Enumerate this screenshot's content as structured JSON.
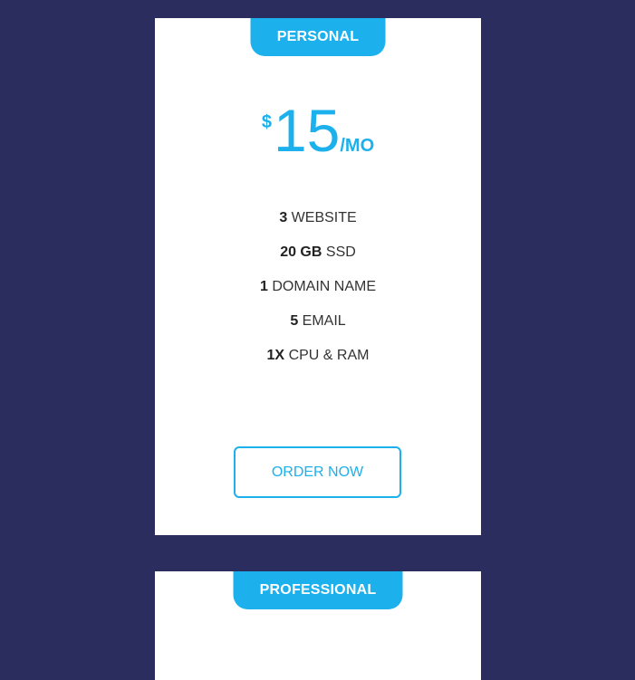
{
  "plans": [
    {
      "name": "PERSONAL",
      "currency": "$",
      "price": "15",
      "period": "/MO",
      "features": [
        {
          "value": "3",
          "label": "WEBSITE"
        },
        {
          "value": "20 GB",
          "label": "SSD"
        },
        {
          "value": "1",
          "label": "DOMAIN NAME"
        },
        {
          "value": "5",
          "label": "EMAIL"
        },
        {
          "value": "1X",
          "label": "CPU & RAM"
        }
      ],
      "button_label": "ORDER NOW"
    },
    {
      "name": "PROFESSIONAL"
    }
  ],
  "colors": {
    "background": "#2b2d5f",
    "accent": "#1cb0ec",
    "card": "#ffffff"
  }
}
